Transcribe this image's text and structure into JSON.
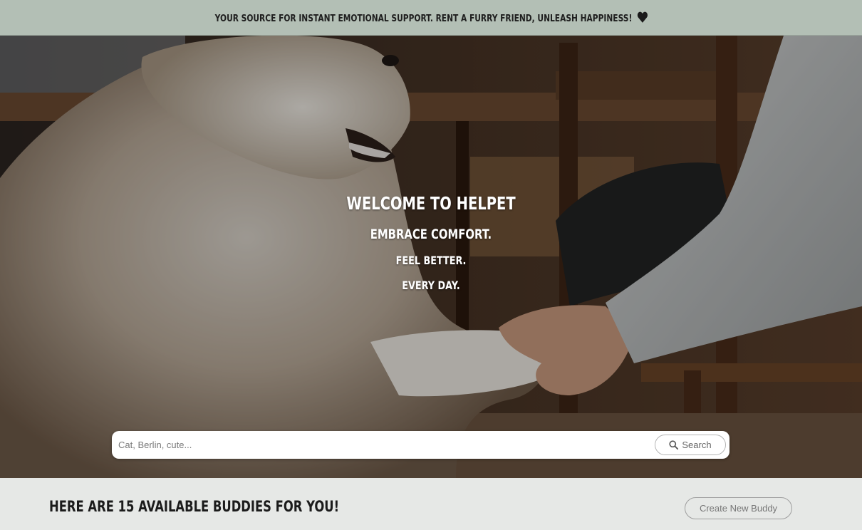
{
  "announcement": {
    "text": "Your source for instant emotional support. Rent a furry friend, unleash happiness!",
    "icon": "heart-icon"
  },
  "hero": {
    "title": "Welcome to HelPet",
    "line1": "Embrace comfort.",
    "line2": "Feel better.",
    "line3": "Every day."
  },
  "search": {
    "placeholder": "Cat, Berlin, cute...",
    "button_label": "Search",
    "icon": "search-icon"
  },
  "buddies": {
    "heading": "Here are 15 available buddies for you!",
    "create_label": "Create New Buddy"
  },
  "colors": {
    "topbar": "#b3bfb5",
    "page_bg": "#e6e8e6"
  }
}
